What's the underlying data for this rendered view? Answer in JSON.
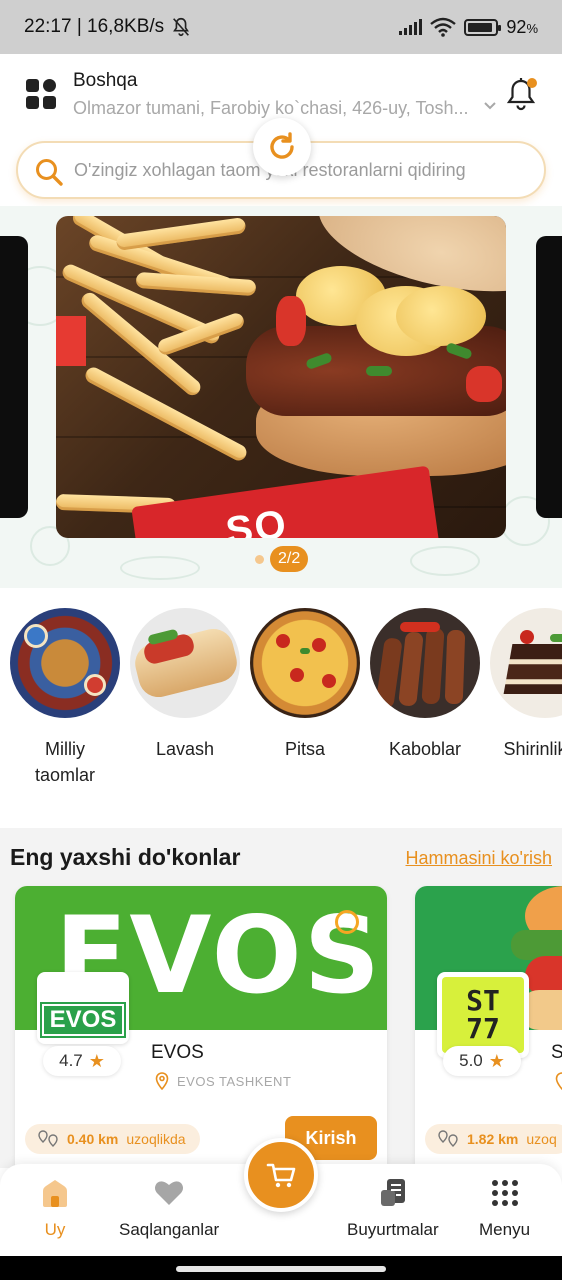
{
  "status_bar": {
    "time_speed": "22:17 | 16,8KB/s",
    "battery": "92",
    "battery_unit": "%",
    "battery_level": 0.92
  },
  "header": {
    "title": "Boshqa",
    "address": "Olmazor tumani, Farobiy ko`chasi, 426-uy, Tosh..."
  },
  "search": {
    "placeholder": "O'zingiz xohlagan taom yoki restoranlarni qidiring"
  },
  "banner": {
    "packet_text": "SO",
    "page_indicator": "2/2",
    "current_page": 2,
    "total_pages": 2
  },
  "categories": [
    {
      "label": "Milliy\ntaomlar",
      "icon": "plov-dish-icon"
    },
    {
      "label": "Lavash",
      "icon": "lavash-wrap-icon"
    },
    {
      "label": "Pitsa",
      "icon": "pizza-icon"
    },
    {
      "label": "Kaboblar",
      "icon": "kebab-skewer-icon"
    },
    {
      "label": "Shirinliklar",
      "icon": "cake-icon"
    }
  ],
  "shops": {
    "title": "Eng yaxshi do'konlar",
    "see_all": "Hammasini ko'rish",
    "items": [
      {
        "cover_text": "EVOS",
        "logo_text": "EVOS",
        "name": "EVOS",
        "rating": "4.7",
        "location": "EVOS TASHKENT",
        "distance": "0.40 km",
        "distance_suffix": "uzoqlikda",
        "button": "Kirish"
      },
      {
        "logo_line1": "ST",
        "logo_line2": "77",
        "name": "S",
        "rating": "5.0",
        "distance": "1.82 km",
        "distance_suffix": "uzoq"
      }
    ]
  },
  "bottom_nav": {
    "items": [
      {
        "label": "Uy",
        "icon": "home-icon",
        "active": true
      },
      {
        "label": "Saqlanganlar",
        "icon": "heart-icon",
        "active": false
      },
      {
        "label": "Buyurtmalar",
        "icon": "orders-icon",
        "active": false
      },
      {
        "label": "Menyu",
        "icon": "menu-dots-icon",
        "active": false
      }
    ],
    "center": {
      "icon": "cart-icon"
    }
  },
  "colors": {
    "accent": "#e8901f",
    "evos_green": "#4caf32",
    "st77_yellow": "#d7f03b"
  }
}
